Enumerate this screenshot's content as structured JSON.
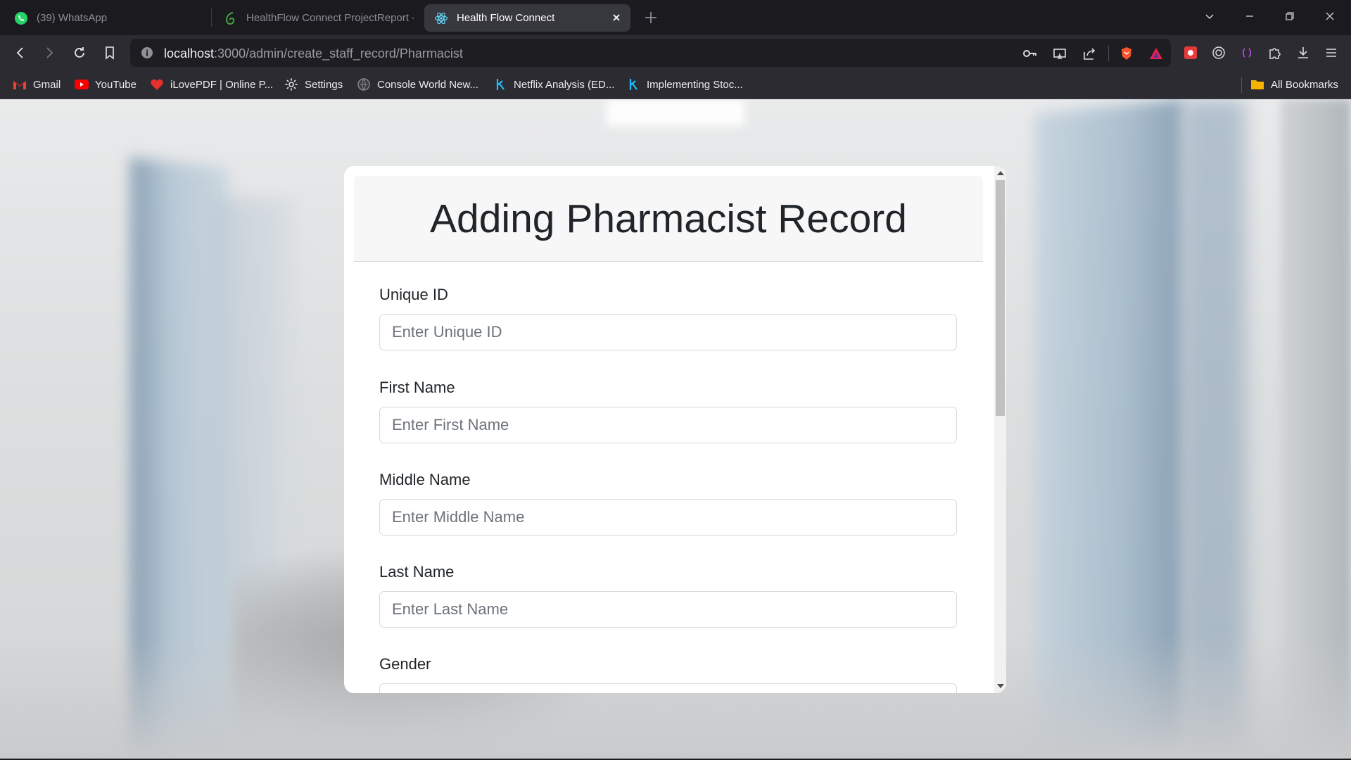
{
  "browser": {
    "tabs": [
      {
        "title": "(39) WhatsApp",
        "icon": "whatsapp-icon",
        "active": false
      },
      {
        "title": "HealthFlow Connect ProjectReport -",
        "icon": "overleaf-icon",
        "active": false
      },
      {
        "title": "Health Flow Connect",
        "icon": "react-icon",
        "active": true
      }
    ],
    "url": {
      "host": "localhost",
      "path": ":3000/admin/create_staff_record/Pharmacist"
    },
    "bookmarks": [
      {
        "label": "Gmail",
        "icon": "gmail-icon"
      },
      {
        "label": "YouTube",
        "icon": "youtube-icon"
      },
      {
        "label": "iLovePDF | Online P...",
        "icon": "ilovepdf-icon"
      },
      {
        "label": "Settings",
        "icon": "gear-icon"
      },
      {
        "label": "Console World New...",
        "icon": "console-world-icon"
      },
      {
        "label": "Netflix Analysis (ED...",
        "icon": "kaggle-icon"
      },
      {
        "label": "Implementing Stoc...",
        "icon": "kaggle-icon"
      }
    ],
    "all_bookmarks_label": "All Bookmarks",
    "colors": {
      "brave_orange": "#fb542b",
      "active_tab": "#37373e",
      "whatsapp_green": "#25d366"
    }
  },
  "form": {
    "title": "Adding Pharmacist Record",
    "fields": [
      {
        "label": "Unique ID",
        "placeholder": "Enter Unique ID",
        "value": ""
      },
      {
        "label": "First Name",
        "placeholder": "Enter First Name",
        "value": ""
      },
      {
        "label": "Middle Name",
        "placeholder": "Enter Middle Name",
        "value": ""
      },
      {
        "label": "Last Name",
        "placeholder": "Enter Last Name",
        "value": ""
      },
      {
        "label": "Gender",
        "placeholder": "",
        "value": ""
      }
    ]
  }
}
